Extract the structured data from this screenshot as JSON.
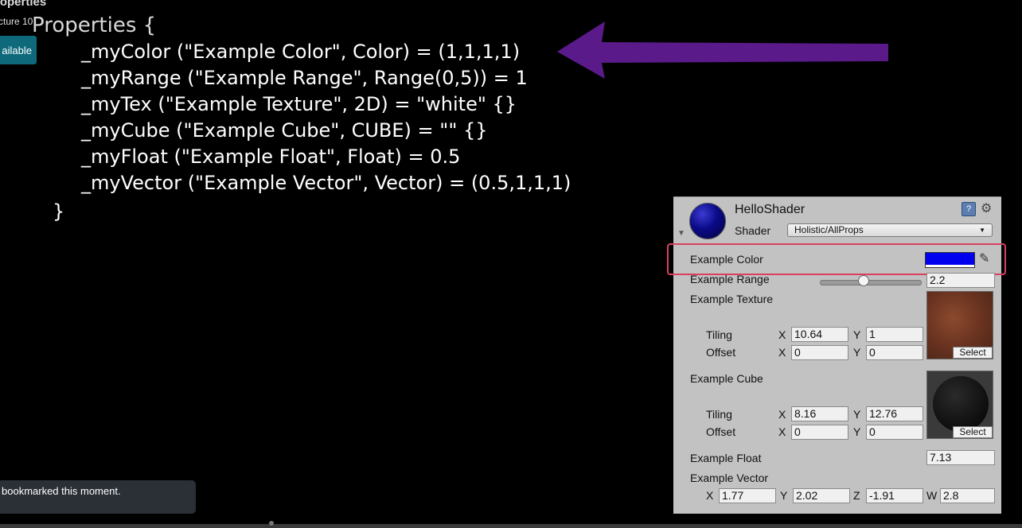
{
  "overlay": {
    "course_title": "roperties",
    "lecture_label": "cture 10",
    "available_button": "ailable",
    "toast_text": "bookmarked this moment."
  },
  "code": {
    "header": "Properties {",
    "lines": [
      "_myColor (\"Example Color\", Color) = (1,1,1,1)",
      "_myRange (\"Example Range\", Range(0,5)) = 1",
      "_myTex (\"Example Texture\", 2D) = \"white\" {}",
      "_myCube (\"Example Cube\", CUBE) = \"\" {}",
      "_myFloat (\"Example Float\", Float) = 0.5",
      "_myVector (\"Example Vector\", Vector) = (0.5,1,1,1)"
    ],
    "close": "}"
  },
  "colors": {
    "arrow": "#5a1a8a",
    "highlight": "#d94060",
    "swatch": "#0000ee"
  },
  "inspector": {
    "material_name": "HelloShader",
    "shader_label": "Shader",
    "shader_value": "Holistic/AllProps",
    "icons": [
      "material-sphere-icon",
      "help-book-icon",
      "gear-icon",
      "eyedropper-icon"
    ],
    "color_label": "Example Color",
    "range_label": "Example Range",
    "range_value": "2.2",
    "range_fraction": 0.44,
    "texture_label": "Example Texture",
    "tex_tiling_label": "Tiling",
    "tex_offset_label": "Offset",
    "tex_tiling_x": "10.64",
    "tex_tiling_y": "1",
    "tex_offset_x": "0",
    "tex_offset_y": "0",
    "cube_label": "Example Cube",
    "cube_tiling_label": "Tiling",
    "cube_offset_label": "Offset",
    "cube_tiling_x": "8.16",
    "cube_tiling_y": "12.76",
    "cube_offset_x": "0",
    "cube_offset_y": "0",
    "select_label": "Select",
    "float_label": "Example Float",
    "float_value": "7.13",
    "vector_label": "Example Vector",
    "vec_x": "1.77",
    "vec_y": "2.02",
    "vec_z": "-1.91",
    "vec_w": "2.8",
    "axis": {
      "x": "X",
      "y": "Y",
      "z": "Z",
      "w": "W"
    }
  }
}
